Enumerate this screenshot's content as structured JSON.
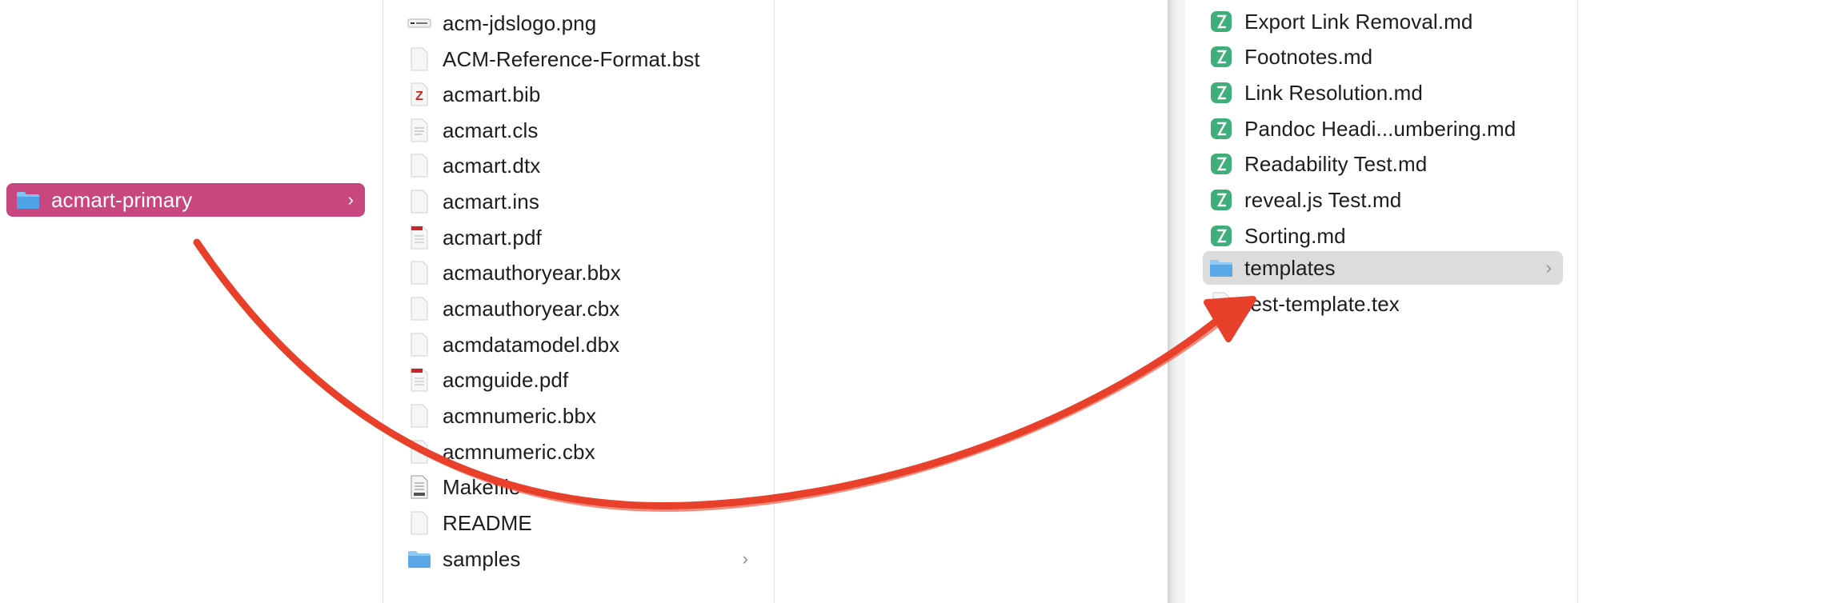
{
  "left_column": {
    "selected_folder": {
      "label": "acmart-primary",
      "icon": "folder-icon"
    }
  },
  "middle_column": {
    "items": [
      {
        "label": "acm-jdslogo.png",
        "icon": "image-file-icon"
      },
      {
        "label": "ACM-Reference-Format.bst",
        "icon": "blank-file-icon"
      },
      {
        "label": "acmart.bib",
        "icon": "bibtex-file-icon"
      },
      {
        "label": "acmart.cls",
        "icon": "text-file-icon"
      },
      {
        "label": "acmart.dtx",
        "icon": "blank-file-icon"
      },
      {
        "label": "acmart.ins",
        "icon": "blank-file-icon"
      },
      {
        "label": "acmart.pdf",
        "icon": "pdf-file-icon"
      },
      {
        "label": "acmauthoryear.bbx",
        "icon": "blank-file-icon"
      },
      {
        "label": "acmauthoryear.cbx",
        "icon": "blank-file-icon"
      },
      {
        "label": "acmdatamodel.dbx",
        "icon": "blank-file-icon"
      },
      {
        "label": "acmguide.pdf",
        "icon": "pdf-file-icon"
      },
      {
        "label": "acmnumeric.bbx",
        "icon": "blank-file-icon"
      },
      {
        "label": "acmnumeric.cbx",
        "icon": "blank-file-icon"
      },
      {
        "label": "Makefile",
        "icon": "makefile-icon"
      },
      {
        "label": "README",
        "icon": "blank-file-icon"
      },
      {
        "label": "samples",
        "icon": "folder-icon"
      }
    ]
  },
  "right_column": {
    "items": [
      {
        "label": "Export Link Removal.md",
        "icon": "markdown-app-icon"
      },
      {
        "label": "Footnotes.md",
        "icon": "markdown-app-icon"
      },
      {
        "label": "Link Resolution.md",
        "icon": "markdown-app-icon"
      },
      {
        "label": "Pandoc Headi...umbering.md",
        "icon": "markdown-app-icon"
      },
      {
        "label": "Readability Test.md",
        "icon": "markdown-app-icon"
      },
      {
        "label": "reveal.js Test.md",
        "icon": "markdown-app-icon"
      },
      {
        "label": "Sorting.md",
        "icon": "markdown-app-icon"
      },
      {
        "label": "templates",
        "icon": "folder-icon"
      },
      {
        "label": "test-template.tex",
        "icon": "blank-file-icon"
      }
    ]
  },
  "annotation": {
    "arrow_color": "#e8402a"
  },
  "colors": {
    "selection": "#c8477f",
    "hover_row": "#dcdcdc",
    "folder": "#5aa9e6",
    "markdown_icon": "#3fae7a"
  }
}
